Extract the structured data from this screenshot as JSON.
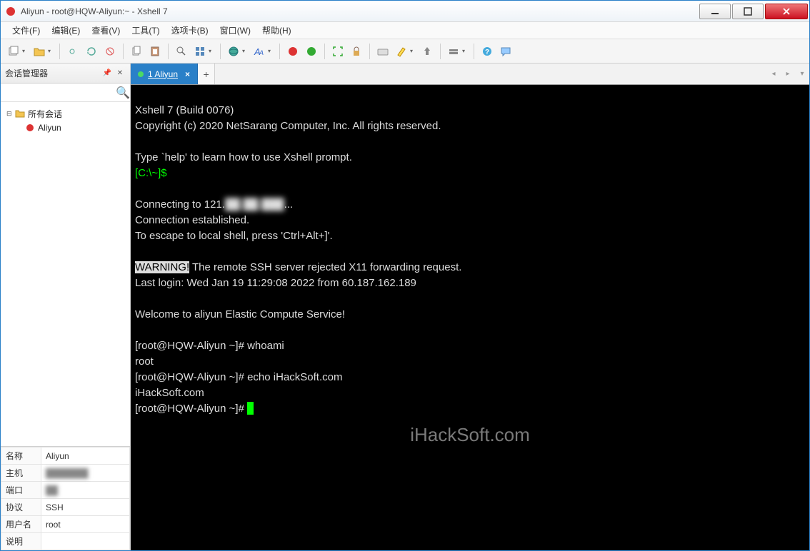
{
  "window": {
    "title": "Aliyun - root@HQW-Aliyun:~ - Xshell 7"
  },
  "menu": {
    "file": "文件(F)",
    "edit": "编辑(E)",
    "view": "查看(V)",
    "tools": "工具(T)",
    "tabs": "选项卡(B)",
    "window": "窗口(W)",
    "help": "帮助(H)"
  },
  "sidebar": {
    "title": "会话管理器",
    "search_placeholder": "",
    "root": "所有会话",
    "items": [
      {
        "name": "Aliyun"
      }
    ]
  },
  "properties": {
    "name_label": "名称",
    "name_value": "Aliyun",
    "host_label": "主机",
    "host_value": "███████",
    "port_label": "端口",
    "port_value": "██",
    "protocol_label": "协议",
    "protocol_value": "SSH",
    "user_label": "用户名",
    "user_value": "root",
    "desc_label": "说明",
    "desc_value": ""
  },
  "tabbar": {
    "tab1_label": "1 Aliyun"
  },
  "terminal": {
    "l1": "Xshell 7 (Build 0076)",
    "l2": "Copyright (c) 2020 NetSarang Computer, Inc. All rights reserved.",
    "l3": "",
    "l4": "Type `help' to learn how to use Xshell prompt.",
    "l5": "[C:\\~]$",
    "l6": "",
    "l7a": "Connecting to 121.",
    "l7b": "██.██.███",
    "l7c": "...",
    "l8": "Connection established.",
    "l9": "To escape to local shell, press 'Ctrl+Alt+]'.",
    "l10": "",
    "l11a": "WARNING!",
    "l11b": " The remote SSH server rejected X11 forwarding request.",
    "l12": "Last login: Wed Jan 19 11:29:08 2022 from 60.187.162.189",
    "l13": "",
    "l14": "Welcome to aliyun Elastic Compute Service!",
    "l15": "",
    "l16": "[root@HQW-Aliyun ~]# whoami",
    "l17": "root",
    "l18": "[root@HQW-Aliyun ~]# echo iHackSoft.com",
    "l19": "iHackSoft.com",
    "l20": "[root@HQW-Aliyun ~]# "
  },
  "watermark": "iHackSoft.com"
}
